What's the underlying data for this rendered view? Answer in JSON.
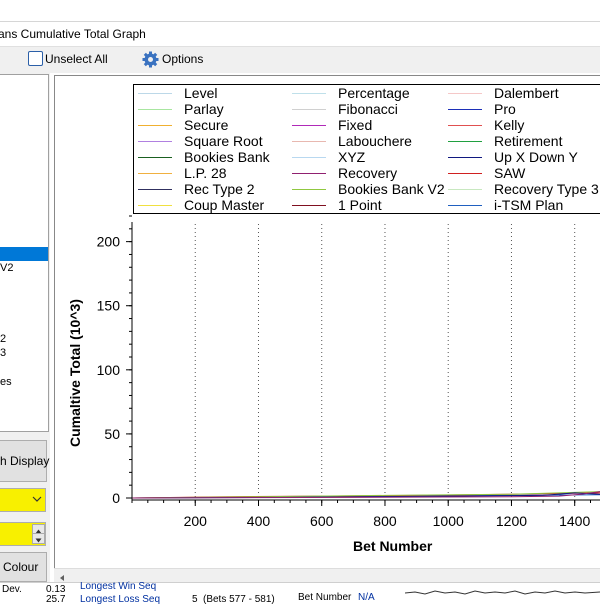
{
  "window": {
    "title": "ans Cumulative Total Graph"
  },
  "toolbar": {
    "unselect_label": "Unselect All",
    "options_label": "Options"
  },
  "left_panel": {
    "list_fragments": [
      "V2",
      "2",
      "3",
      "es"
    ],
    "graph_display_label": "h Display",
    "colour_label": "Colour"
  },
  "legend": {
    "items": [
      {
        "label": "Level",
        "color": "#bcd8e8"
      },
      {
        "label": "Percentage",
        "color": "#bfe0ea"
      },
      {
        "label": "Dalembert",
        "color": "#f5c8c8"
      },
      {
        "label": "Parlay",
        "color": "#a8e6a0"
      },
      {
        "label": "Fibonacci",
        "color": "#d0d0d0"
      },
      {
        "label": "Pro",
        "color": "#1c2fb8"
      },
      {
        "label": "Secure",
        "color": "#f0b030"
      },
      {
        "label": "Fixed",
        "color": "#b02ab8"
      },
      {
        "label": "Kelly",
        "color": "#e05050"
      },
      {
        "label": "Square Root",
        "color": "#b080e0"
      },
      {
        "label": "Labouchere",
        "color": "#e8b8b0"
      },
      {
        "label": "Retirement",
        "color": "#20a040"
      },
      {
        "label": "Bookies Bank",
        "color": "#1a6020"
      },
      {
        "label": "XYZ",
        "color": "#b8d8f0"
      },
      {
        "label": "Up X Down Y",
        "color": "#101880"
      },
      {
        "label": "L.P. 28",
        "color": "#f0b040"
      },
      {
        "label": "Recovery",
        "color": "#902070"
      },
      {
        "label": "SAW",
        "color": "#d02020"
      },
      {
        "label": "Rec Type 2",
        "color": "#303060"
      },
      {
        "label": "Bookies Bank V2",
        "color": "#90c840"
      },
      {
        "label": "Recovery Type 3",
        "color": "#c8e8c0"
      },
      {
        "label": "Coup Master",
        "color": "#f0e040"
      },
      {
        "label": "1 Point",
        "color": "#801020"
      },
      {
        "label": "i-TSM Plan",
        "color": "#2060c0"
      }
    ]
  },
  "chart_data": {
    "type": "line",
    "ylabel": "Cumaltive Total (10^3)",
    "xlabel": "Bet Number",
    "x_ticks": [
      200,
      400,
      600,
      800,
      1000,
      1200,
      1400
    ],
    "y_ticks": [
      0,
      50,
      100,
      150,
      200
    ],
    "xlim": [
      0,
      1480
    ],
    "ylim": [
      0,
      220
    ],
    "grid": "vertical dotted",
    "series": [
      {
        "color": "#2060c0",
        "points": [
          [
            0,
            0
          ],
          [
            300,
            0.5
          ],
          [
            600,
            1
          ],
          [
            900,
            1.5
          ],
          [
            1200,
            2
          ],
          [
            1480,
            2.5
          ]
        ]
      },
      {
        "color": "#d02020",
        "points": [
          [
            0,
            0
          ],
          [
            300,
            1
          ],
          [
            600,
            1.5
          ],
          [
            900,
            2
          ],
          [
            1200,
            3
          ],
          [
            1480,
            4
          ]
        ]
      },
      {
        "color": "#90c840",
        "points": [
          [
            0,
            0
          ],
          [
            400,
            1
          ],
          [
            800,
            2
          ],
          [
            1200,
            3
          ],
          [
            1480,
            5
          ]
        ]
      },
      {
        "color": "#101880",
        "points": [
          [
            0,
            0
          ],
          [
            500,
            0.5
          ],
          [
            1000,
            1.5
          ],
          [
            1300,
            2
          ],
          [
            1400,
            4
          ],
          [
            1480,
            3
          ]
        ]
      },
      {
        "color": "#902070",
        "points": [
          [
            0,
            0
          ],
          [
            700,
            0.5
          ],
          [
            1200,
            1
          ],
          [
            1350,
            1.5
          ],
          [
            1420,
            3
          ],
          [
            1480,
            5
          ]
        ]
      }
    ]
  },
  "status": {
    "dev_label": "Dev.",
    "dev_value": "0.13",
    "val2": "25.7",
    "longest_win_label": "Longest Win Seq",
    "longest_loss_label": "Longest Loss Seq",
    "loss_value": "5",
    "loss_range": "(Bets 577 - 581)",
    "bet_number_label": "Bet Number",
    "bet_number_value": "N/A"
  }
}
